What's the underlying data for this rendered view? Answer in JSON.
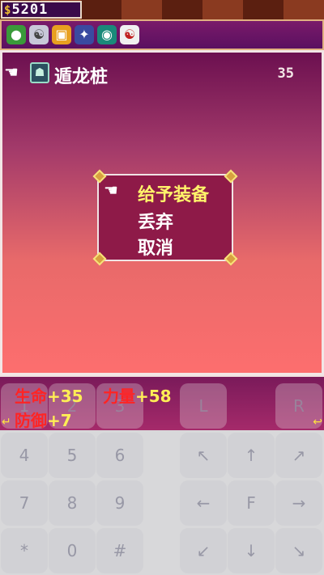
{
  "top": {
    "currency_symbol": "$",
    "money": "5201"
  },
  "icons": [
    "gourd-icon",
    "dragon-icon",
    "chest-icon",
    "armor-icon",
    "orb-icon",
    "yinyang-icon"
  ],
  "item": {
    "name": "遁龙桩",
    "count": "35"
  },
  "menu": {
    "options": [
      "给予装备",
      "丢弃",
      "取消"
    ],
    "selected": 0
  },
  "stats": [
    {
      "key": "生命",
      "value": "+35"
    },
    {
      "key": "力量",
      "value": "+58"
    },
    {
      "key": "防御",
      "value": "+7"
    }
  ],
  "keypad": {
    "row0": [
      "1",
      "2",
      "3",
      "L",
      "R"
    ],
    "row1": [
      "4",
      "5",
      "6",
      "↖",
      "↑",
      "↗"
    ],
    "row2": [
      "7",
      "8",
      "9",
      "←",
      "F",
      "→"
    ],
    "row3": [
      "*",
      "0",
      "#",
      "↙",
      "↓",
      "↘"
    ]
  }
}
